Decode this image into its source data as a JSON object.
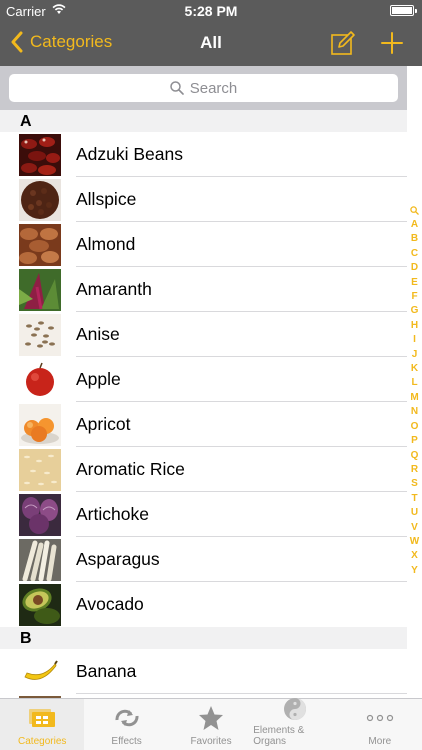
{
  "status": {
    "carrier": "Carrier",
    "time": "5:28 PM"
  },
  "nav": {
    "back_label": "Categories",
    "title": "All"
  },
  "search": {
    "placeholder": "Search"
  },
  "sections": [
    {
      "letter": "A",
      "items": [
        {
          "label": "Adzuki Beans",
          "icon": "adzuki-beans"
        },
        {
          "label": "Allspice",
          "icon": "allspice"
        },
        {
          "label": "Almond",
          "icon": "almond"
        },
        {
          "label": "Amaranth",
          "icon": "amaranth"
        },
        {
          "label": "Anise",
          "icon": "anise"
        },
        {
          "label": "Apple",
          "icon": "apple"
        },
        {
          "label": "Apricot",
          "icon": "apricot"
        },
        {
          "label": "Aromatic Rice",
          "icon": "aromatic-rice"
        },
        {
          "label": "Artichoke",
          "icon": "artichoke"
        },
        {
          "label": "Asparagus",
          "icon": "asparagus"
        },
        {
          "label": "Avocado",
          "icon": "avocado"
        }
      ]
    },
    {
      "letter": "B",
      "items": [
        {
          "label": "Banana",
          "icon": "banana"
        }
      ]
    }
  ],
  "index_letters": [
    "A",
    "B",
    "C",
    "D",
    "E",
    "F",
    "G",
    "H",
    "I",
    "J",
    "K",
    "L",
    "M",
    "N",
    "O",
    "P",
    "Q",
    "R",
    "S",
    "T",
    "U",
    "V",
    "W",
    "X",
    "Y"
  ],
  "tabs": [
    {
      "label": "Categories",
      "icon": "categories-icon",
      "active": true
    },
    {
      "label": "Effects",
      "icon": "effects-icon",
      "active": false
    },
    {
      "label": "Favorites",
      "icon": "star-icon",
      "active": false
    },
    {
      "label": "Elements & Organs",
      "icon": "yin-yang-icon",
      "active": false
    },
    {
      "label": "More",
      "icon": "more-icon",
      "active": false
    }
  ],
  "colors": {
    "accent": "#f2b91d",
    "bar": "#5b5b5b",
    "search_bg": "#c9c9ce"
  }
}
